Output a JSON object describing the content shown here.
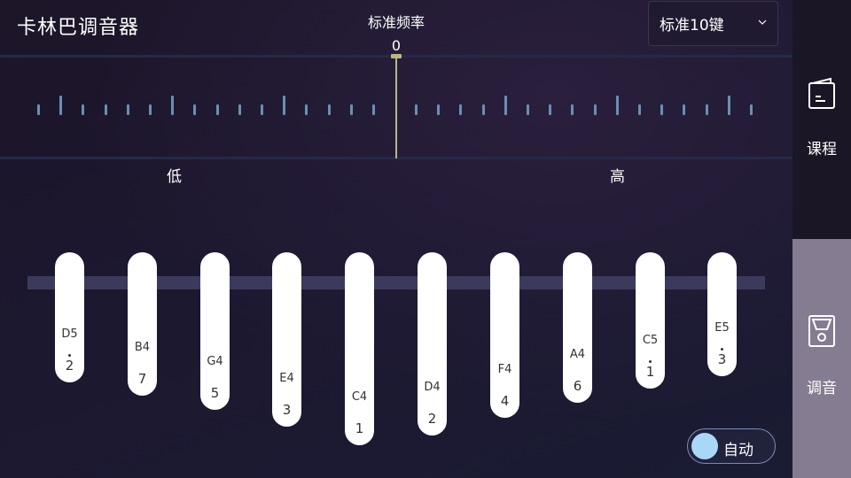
{
  "header": {
    "app_title": "卡林巴调音器",
    "freq_title": "标准频率",
    "freq_value": "0",
    "key_select": "标准10键"
  },
  "scale": {
    "low_label": "低",
    "high_label": "高"
  },
  "tines": [
    {
      "note": "D5",
      "num": "2",
      "dot": "above"
    },
    {
      "note": "B4",
      "num": "7",
      "dot": "none"
    },
    {
      "note": "G4",
      "num": "5",
      "dot": "none"
    },
    {
      "note": "E4",
      "num": "3",
      "dot": "none"
    },
    {
      "note": "C4",
      "num": "1",
      "dot": "none"
    },
    {
      "note": "D4",
      "num": "2",
      "dot": "none"
    },
    {
      "note": "F4",
      "num": "4",
      "dot": "none"
    },
    {
      "note": "A4",
      "num": "6",
      "dot": "none"
    },
    {
      "note": "C5",
      "num": "1",
      "dot": "above"
    },
    {
      "note": "E5",
      "num": "3",
      "dot": "above"
    }
  ],
  "auto_toggle": {
    "label": "自动",
    "state": "on"
  },
  "sidebar": {
    "items": [
      {
        "label": "课程",
        "icon": "book-icon",
        "active": false
      },
      {
        "label": "调音",
        "icon": "tuner-icon",
        "active": true
      }
    ]
  },
  "colors": {
    "needle": "#b9b68a",
    "tick": "#6a8fb4",
    "active_tab": "#857c92",
    "toggle_knob": "#a8d8f5"
  }
}
